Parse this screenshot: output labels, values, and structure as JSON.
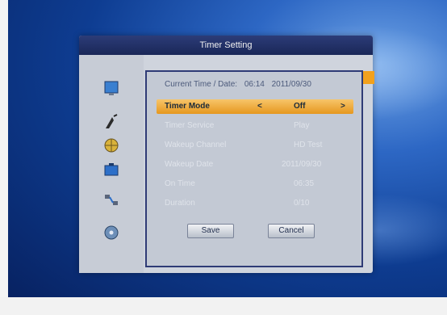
{
  "window": {
    "title": "Timer Setting"
  },
  "current_time": {
    "label": "Current Time / Date:",
    "time": "06:14",
    "date": "2011/09/30"
  },
  "rows": [
    {
      "label": "Timer Mode",
      "value": "Off",
      "selected": true
    },
    {
      "label": "Timer Service",
      "value": "Play"
    },
    {
      "label": "Wakeup Channel",
      "value": "HD Test"
    },
    {
      "label": "Wakeup Date",
      "value": "2011/09/30"
    },
    {
      "label": "On Time",
      "value": "06:35"
    },
    {
      "label": "Duration",
      "value": "0/10"
    }
  ],
  "buttons": {
    "save": "Save",
    "cancel": "Cancel"
  },
  "arrows": {
    "left": "<",
    "right": ">"
  },
  "icons": [
    "monitor-icon",
    "satellite-dish-icon",
    "globe-icon",
    "briefcase-icon",
    "network-icon",
    "disc-icon"
  ],
  "colors": {
    "highlight": "#f2a11d",
    "title_bar": "#1a2758"
  }
}
